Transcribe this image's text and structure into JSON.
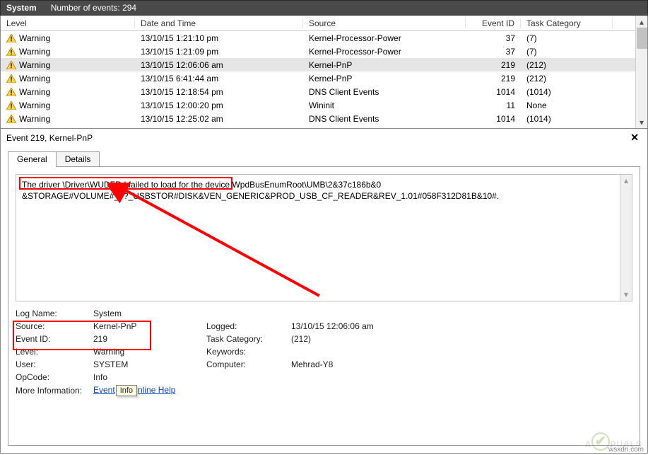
{
  "topbar": {
    "title": "System",
    "count_label": "Number of events: 294"
  },
  "columns": {
    "level": "Level",
    "date": "Date and Time",
    "source": "Source",
    "event_id": "Event ID",
    "task": "Task Category"
  },
  "rows": [
    {
      "level": "Warning",
      "date": "13/10/15 1:21:10 pm",
      "source": "Kernel-Processor-Power",
      "event_id": "37",
      "task": "(7)",
      "selected": false
    },
    {
      "level": "Warning",
      "date": "13/10/15 1:21:09 pm",
      "source": "Kernel-Processor-Power",
      "event_id": "37",
      "task": "(7)",
      "selected": false
    },
    {
      "level": "Warning",
      "date": "13/10/15 12:06:06 am",
      "source": "Kernel-PnP",
      "event_id": "219",
      "task": "(212)",
      "selected": true
    },
    {
      "level": "Warning",
      "date": "13/10/15 6:41:44 am",
      "source": "Kernel-PnP",
      "event_id": "219",
      "task": "(212)",
      "selected": false
    },
    {
      "level": "Warning",
      "date": "13/10/15 12:18:54 pm",
      "source": "DNS Client Events",
      "event_id": "1014",
      "task": "(1014)",
      "selected": false
    },
    {
      "level": "Warning",
      "date": "13/10/15 12:00:20 pm",
      "source": "Wininit",
      "event_id": "11",
      "task": "None",
      "selected": false
    },
    {
      "level": "Warning",
      "date": "13/10/15 12:25:02 am",
      "source": "DNS Client Events",
      "event_id": "1014",
      "task": "(1014)",
      "selected": false
    }
  ],
  "detail": {
    "title": "Event 219, Kernel-PnP",
    "close_glyph": "✕",
    "tabs": {
      "general": "General",
      "details": "Details"
    },
    "description_line1_a": "The driver \\Driver\\WUDFRd failed to load for the device ",
    "description_line1_b": "WpdBusEnumRoot\\UMB\\2&37c186b&0",
    "description_line2": "&STORAGE#VOLUME#_??_USBSTOR#DISK&VEN_GENERIC&PROD_USB_CF_READER&REV_1.01#058F312D81B&10#.",
    "labels": {
      "log_name": "Log Name:",
      "source": "Source:",
      "event_id": "Event ID:",
      "level": "Level:",
      "user": "User:",
      "opcode": "OpCode:",
      "more_info": "More Information:",
      "logged": "Logged:",
      "task_category": "Task Category:",
      "keywords": "Keywords:",
      "computer": "Computer:"
    },
    "values": {
      "log_name": "System",
      "source": "Kernel-PnP",
      "event_id": "219",
      "level": "Warning",
      "user": "SYSTEM",
      "opcode": "Info",
      "logged": "13/10/15 12:06:06 am",
      "task_category": "(212)",
      "keywords": "",
      "computer": "Mehrad-Y8"
    },
    "link_left": "Event",
    "link_right": "nline Help",
    "tooltip": "Info"
  },
  "watermark": {
    "text_left": "A",
    "text_right": "PUALS",
    "corner": "wsxdn.com"
  }
}
